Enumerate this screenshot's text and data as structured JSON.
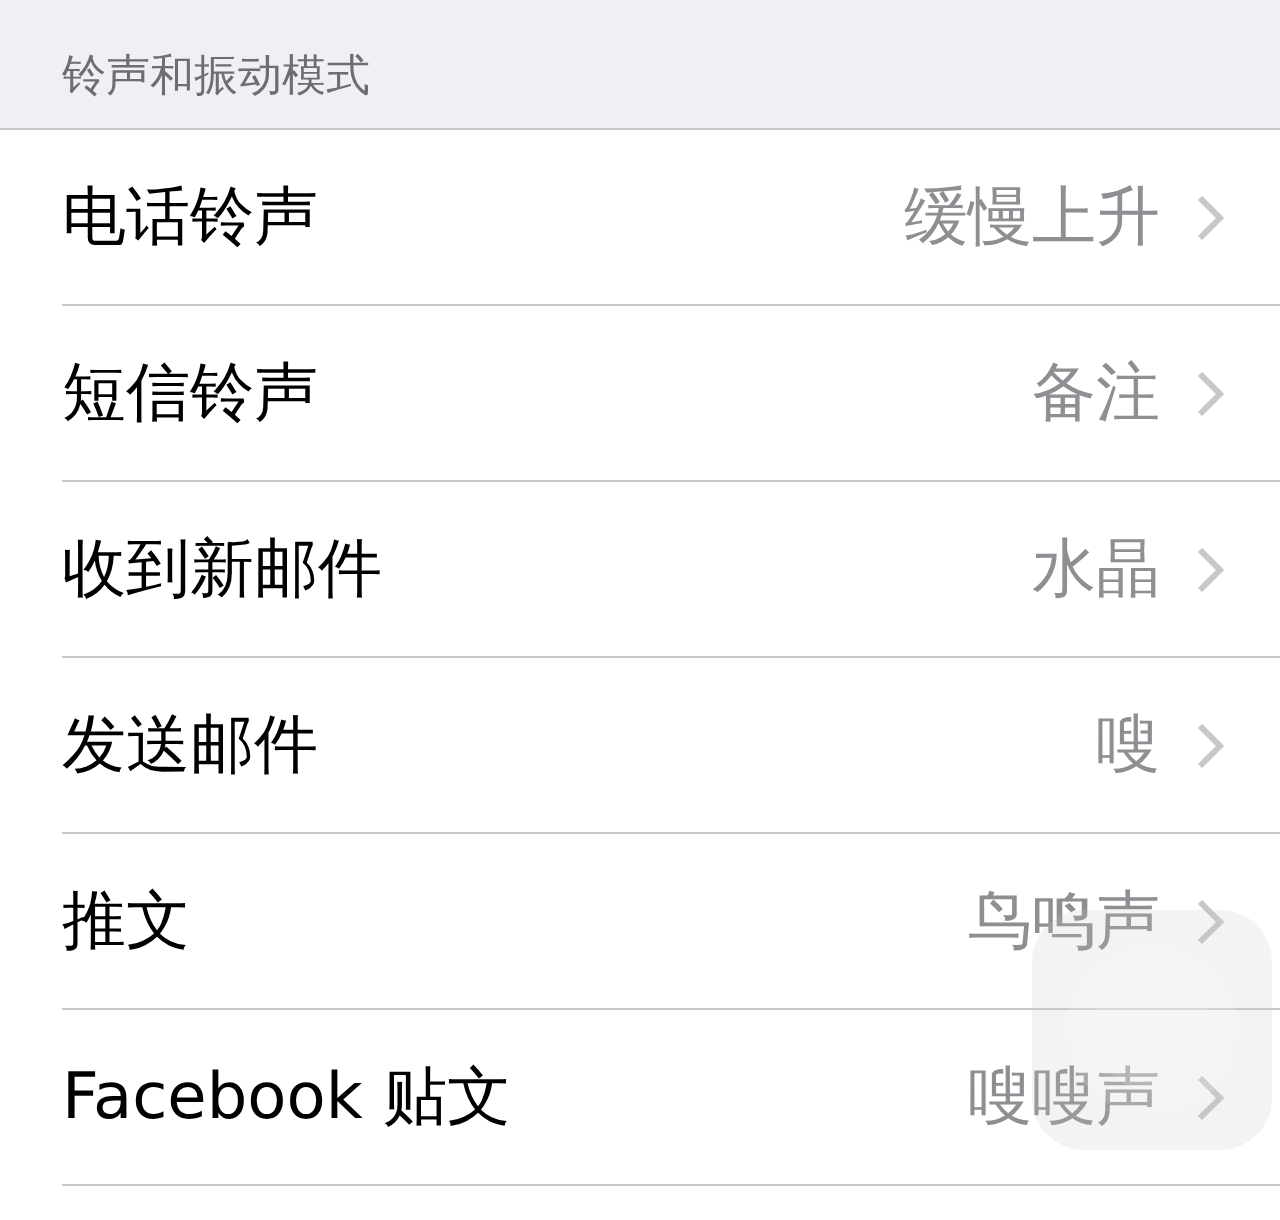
{
  "section": {
    "title": "铃声和振动模式"
  },
  "rows": [
    {
      "label": "电话铃声",
      "value": "缓慢上升"
    },
    {
      "label": "短信铃声",
      "value": "备注"
    },
    {
      "label": "收到新邮件",
      "value": "水晶"
    },
    {
      "label": "发送邮件",
      "value": "嗖"
    },
    {
      "label": "推文",
      "value": "鸟鸣声"
    },
    {
      "label": "Facebook 贴文",
      "value": "嗖嗖声"
    }
  ]
}
